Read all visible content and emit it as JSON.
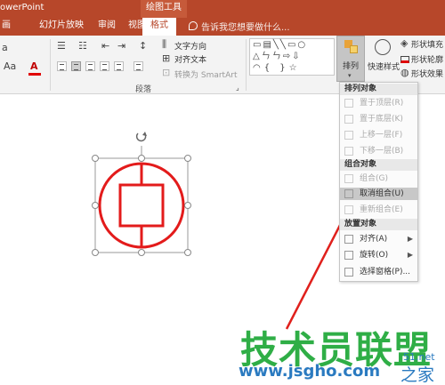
{
  "titlebar": {
    "app_title": "owerPoint",
    "tool_context": "绘图工具"
  },
  "tabs": [
    {
      "label": "画"
    },
    {
      "label": "幻灯片放映"
    },
    {
      "label": "审阅"
    },
    {
      "label": "视图"
    },
    {
      "label": "格式"
    }
  ],
  "tellme": {
    "placeholder": "告诉我您想要做什么..."
  },
  "ribbon": {
    "text_direction": "文字方向",
    "align_text": "对齐文本",
    "convert_smartart": "转换为 SmartArt",
    "paragraph_group": "段落",
    "font_size_glyph": "Aa",
    "font_color_glyph": "A",
    "arrange": "排列",
    "quick_styles": "快速样式",
    "shape_fill": "形状填充",
    "shape_outline": "形状轮廓",
    "shape_effects": "形状效果",
    "gallery_row1": "▭▤╲╲▭○",
    "gallery_row2": "△ㄣㄣ⇨⇩",
    "gallery_row3": "◠{ }☆"
  },
  "menu": {
    "header_arrange": "排列对象",
    "bring_front": "置于顶层(R)",
    "send_back": "置于底层(K)",
    "bring_forward": "上移一层(F)",
    "send_backward": "下移一层(B)",
    "header_group": "组合对象",
    "group": "组合(G)",
    "ungroup": "取消组合(U)",
    "regroup": "重新组合(E)",
    "header_place": "放置对象",
    "align": "对齐(A)",
    "rotate": "旋转(O)",
    "selection_pane": "选择窗格(P)..."
  },
  "watermark": {
    "brand": "技术员联盟",
    "url": "www.jsgho.com",
    "suffix": "51.net",
    "home": "之家"
  },
  "colors": {
    "titlebar": "#b7472a",
    "shape_stroke": "#e31b1b",
    "selection_handle": "#888888",
    "watermark_green": "#2fae46",
    "watermark_blue": "#2a7ac0"
  }
}
